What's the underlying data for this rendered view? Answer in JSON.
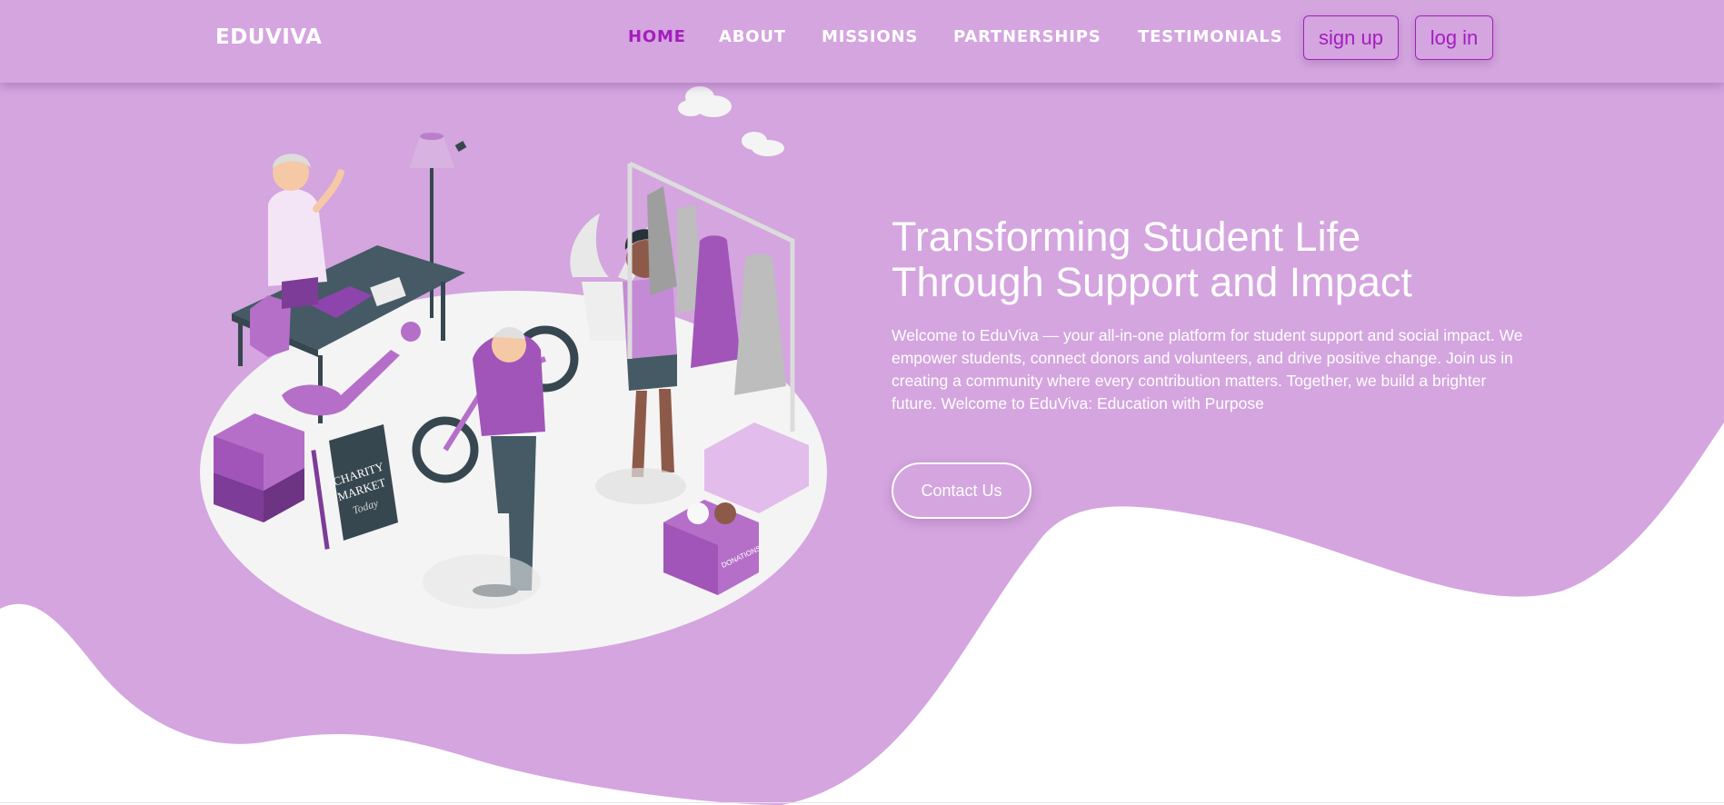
{
  "theme": {
    "background": "#d4a5df",
    "accent": "#a51dbf",
    "text": "#ffffff"
  },
  "header": {
    "logo": "EDUVIVA",
    "nav": [
      {
        "label": "HOME",
        "active": true
      },
      {
        "label": "ABOUT",
        "active": false
      },
      {
        "label": "MISSIONS",
        "active": false
      },
      {
        "label": "PARTNERSHIPS",
        "active": false
      },
      {
        "label": "TESTIMONIALS",
        "active": false
      }
    ],
    "signup_label": "sign up",
    "login_label": "log in"
  },
  "hero": {
    "title_line1": "Transforming Student Life",
    "title_line2": "Through Support and Impact",
    "description": "Welcome to EduViva — your all-in-one platform for student support and social impact. We empower students, connect donors and volunteers, and drive positive change. Join us in creating a community where every contribution matters. Together, we build a brighter future. Welcome to EduViva: Education with Purpose",
    "cta_label": "Contact Us"
  },
  "illustration": {
    "sign_line1": "CHARITY",
    "sign_line2": "MARKET",
    "sign_line3": "Today",
    "box_label": "DONATIONS"
  },
  "icons": [
    "cloud-icon",
    "lamp-icon",
    "price-tag-icon"
  ]
}
